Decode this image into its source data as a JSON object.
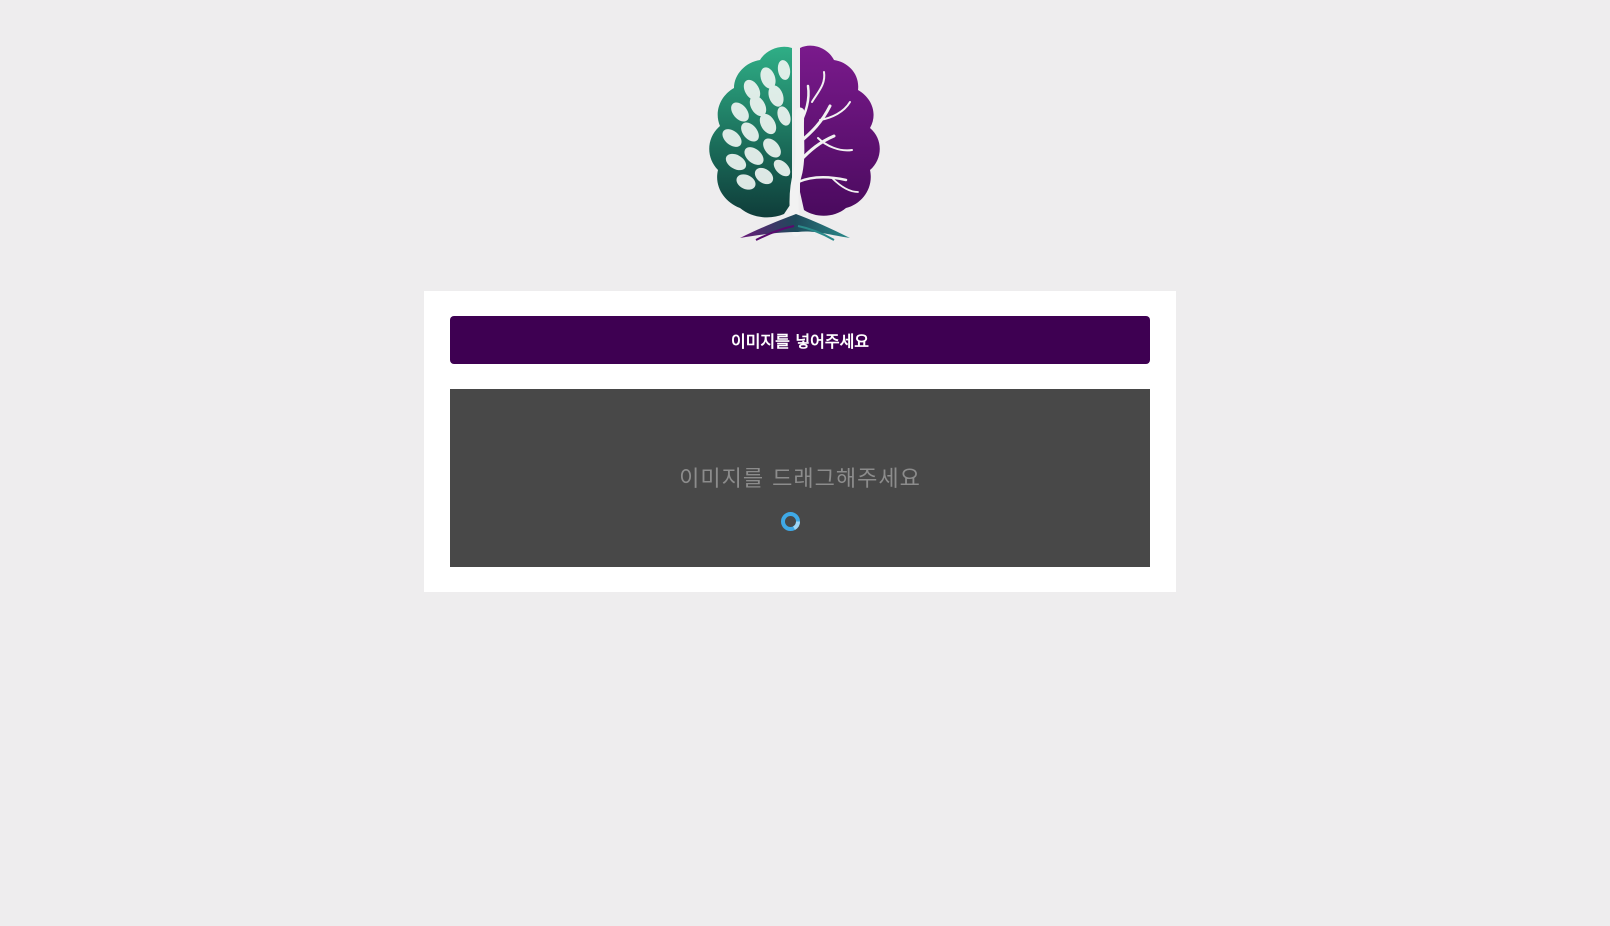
{
  "logo": {
    "name": "tree-brain-logo"
  },
  "upload_panel": {
    "button_label": "이미지를 넣어주세요",
    "dropzone_text": "이미지를 드래그해주세요"
  },
  "colors": {
    "background": "#eeedee",
    "panel": "#ffffff",
    "button": "#3e0052",
    "dropzone": "#484848",
    "spinner": "#3fa9e6",
    "logo_green": "#1f9c7a",
    "logo_purple": "#5a0a6e"
  },
  "icons": {
    "logo": "tree-brain-icon",
    "spinner": "loading-spinner-icon"
  }
}
